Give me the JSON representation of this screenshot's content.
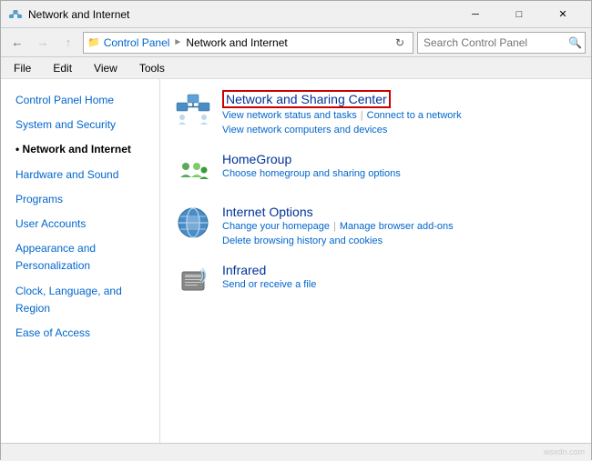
{
  "titleBar": {
    "title": "Network and Internet",
    "minimizeLabel": "─",
    "maximizeLabel": "□",
    "closeLabel": "✕"
  },
  "navBar": {
    "backLabel": "←",
    "forwardLabel": "→",
    "upLabel": "↑",
    "breadcrumb": [
      "Control Panel",
      "Network and Internet"
    ],
    "refreshLabel": "↺",
    "searchPlaceholder": "Search Control Panel"
  },
  "menuBar": {
    "items": [
      "File",
      "Edit",
      "View",
      "Tools"
    ]
  },
  "sidebar": {
    "items": [
      {
        "label": "Control Panel Home",
        "active": false
      },
      {
        "label": "System and Security",
        "active": false
      },
      {
        "label": "Network and Internet",
        "active": true
      },
      {
        "label": "Hardware and Sound",
        "active": false
      },
      {
        "label": "Programs",
        "active": false
      },
      {
        "label": "User Accounts",
        "active": false
      },
      {
        "label": "Appearance and\nPersonalization",
        "active": false
      },
      {
        "label": "Clock, Language, and Region",
        "active": false
      },
      {
        "label": "Ease of Access",
        "active": false
      }
    ]
  },
  "content": {
    "sections": [
      {
        "id": "network-sharing",
        "title": "Network and Sharing Center",
        "highlighted": true,
        "links": [
          {
            "label": "View network status and tasks",
            "sep": true
          },
          {
            "label": "Connect to a network",
            "sep": false
          },
          {
            "label": "View network computers and devices",
            "sep": false
          }
        ]
      },
      {
        "id": "homegroup",
        "title": "HomeGroup",
        "highlighted": false,
        "links": [
          {
            "label": "Choose homegroup and sharing options",
            "sep": false
          }
        ]
      },
      {
        "id": "internet-options",
        "title": "Internet Options",
        "highlighted": false,
        "links": [
          {
            "label": "Change your homepage",
            "sep": true
          },
          {
            "label": "Manage browser add-ons",
            "sep": false
          },
          {
            "label": "Delete browsing history and cookies",
            "sep": false
          }
        ]
      },
      {
        "id": "infrared",
        "title": "Infrared",
        "highlighted": false,
        "links": [
          {
            "label": "Send or receive a file",
            "sep": false
          }
        ]
      }
    ]
  },
  "statusBar": {
    "text": ""
  },
  "watermark": "wsxdn.com"
}
